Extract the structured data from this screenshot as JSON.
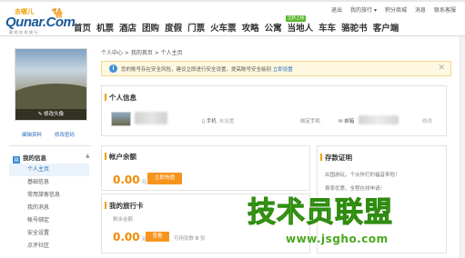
{
  "header": {
    "logo_cn": "去哪儿",
    "logo_camel": "🐪",
    "logo_en": "Qunar.Com",
    "logo_slogan": "聪明你的旅行",
    "topbar": [
      "退出",
      "我的旅行 ▾",
      "积分商城",
      "消息",
      "联系客服"
    ],
    "nav": [
      "首页",
      "机票",
      "酒店",
      "团购",
      "度假",
      "门票",
      "火车票",
      "攻略",
      "公寓",
      "当地人",
      "车车",
      "骆驼书",
      "客户端"
    ],
    "nav_badge": "全新上线"
  },
  "breadcrumb": "个人中心 > 我的首页 > 个人主页",
  "notice": {
    "icon": "i",
    "text": "您的账号存在安全风险，建议立即进行安全设置，提高账号安全级别",
    "link": "立即设置",
    "close": "✕"
  },
  "sidebar": {
    "avatar_edit": "✎ 修改头像",
    "links": [
      "编辑资料",
      "修改密码"
    ],
    "section_title": "我的信息",
    "section_arrow": "▲",
    "items": [
      "个人主页",
      "基础信息",
      "常用旅客信息",
      "我的消息",
      "帐号绑定",
      "安全设置",
      "点评社区"
    ]
  },
  "profile": {
    "title": "个人信息",
    "phone_label": "手机",
    "phone_status": "未设置",
    "bind_phone": "绑定手机",
    "email_label": "邮箱",
    "modify": "修改"
  },
  "balance": {
    "title": "帐户余额",
    "amount": "0.00",
    "unit": "元",
    "button": "立即充值"
  },
  "travel_card": {
    "title": "我的旅行卡",
    "subtitle": "剩余金额",
    "amount": "0.00",
    "unit": "元",
    "button": "查看",
    "available_label": "可用张数",
    "available_count": "0",
    "available_unit": "张"
  },
  "deposit": {
    "title": "存款证明",
    "lines": [
      "出国游玩，个伙伴们的福音来啦！",
      "费率优惠，全程在线申请！"
    ]
  },
  "watermark": {
    "text": "技术员联盟",
    "url": "www.jsgho.com"
  }
}
